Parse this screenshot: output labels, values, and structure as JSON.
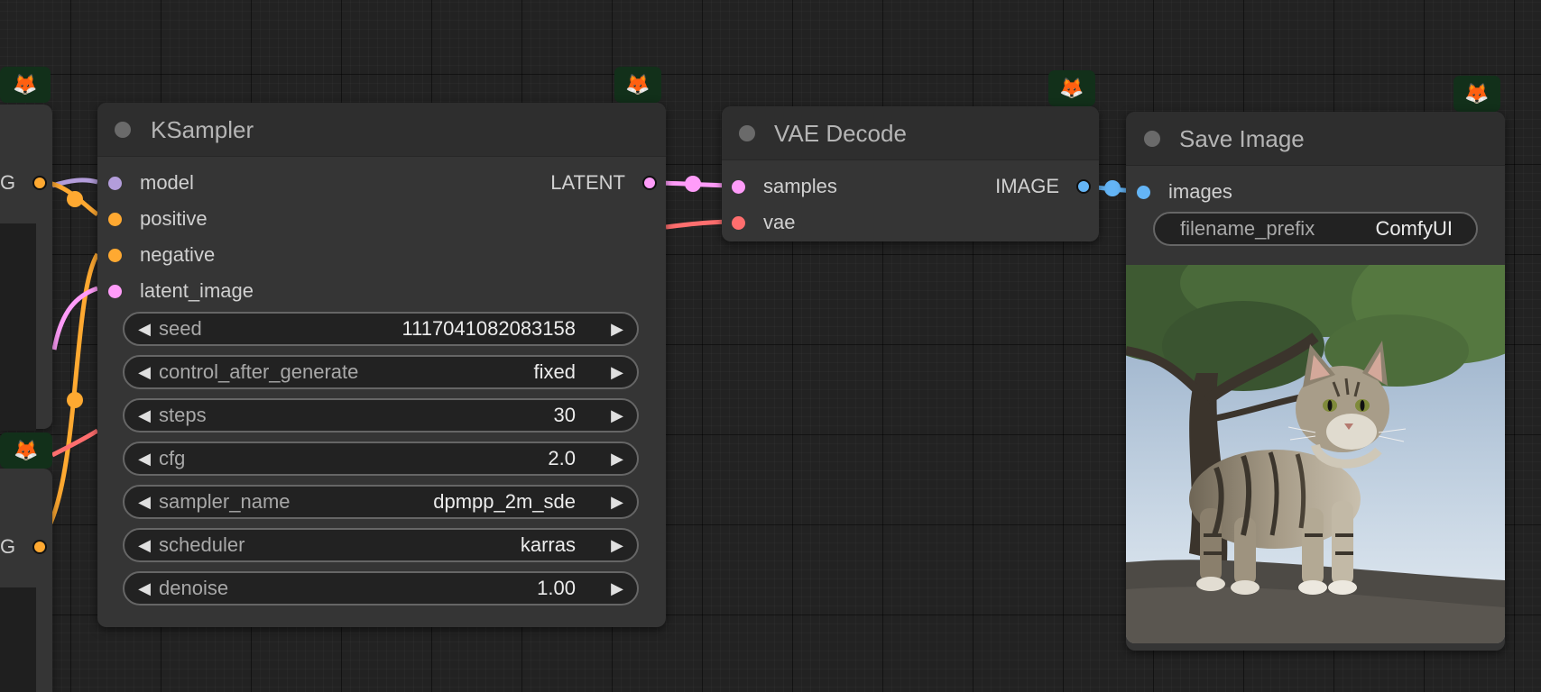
{
  "ksampler": {
    "title": "KSampler",
    "inputs": [
      {
        "label": "model",
        "color": "#b39ddb"
      },
      {
        "label": "positive",
        "color": "#ffa931"
      },
      {
        "label": "negative",
        "color": "#ffa931"
      },
      {
        "label": "latent_image",
        "color": "#ff9cf9"
      }
    ],
    "output": {
      "label": "LATENT",
      "color": "#ff9cf9"
    },
    "widgets": [
      {
        "label": "seed",
        "value": "1117041082083158"
      },
      {
        "label": "control_after_generate",
        "value": "fixed"
      },
      {
        "label": "steps",
        "value": "30"
      },
      {
        "label": "cfg",
        "value": "2.0"
      },
      {
        "label": "sampler_name",
        "value": "dpmpp_2m_sde"
      },
      {
        "label": "scheduler",
        "value": "karras"
      },
      {
        "label": "denoise",
        "value": "1.00"
      }
    ]
  },
  "vae_decode": {
    "title": "VAE Decode",
    "inputs": [
      {
        "label": "samples",
        "color": "#ff9cf9"
      },
      {
        "label": "vae",
        "color": "#ff6e6e"
      }
    ],
    "output": {
      "label": "IMAGE",
      "color": "#64b5f6"
    }
  },
  "save_image": {
    "title": "Save Image",
    "input": {
      "label": "images",
      "color": "#64b5f6"
    },
    "filename_prefix": {
      "label": "filename_prefix",
      "value": "ComfyUI"
    },
    "preview_icon": "cat-image"
  },
  "offscreen_nodes": {
    "top_output_label": "G",
    "bottom_output_label": "G",
    "output_color": "#ffa931"
  },
  "badge_icon": "🦊",
  "colors": {
    "background": "#222222",
    "node_body": "#353535",
    "node_title": "#2e2e2e",
    "link_clip": "#ffa931",
    "link_latent": "#ff9cf9",
    "link_vae": "#ff6e6e",
    "link_image": "#64b5f6",
    "link_model": "#b39ddb"
  }
}
